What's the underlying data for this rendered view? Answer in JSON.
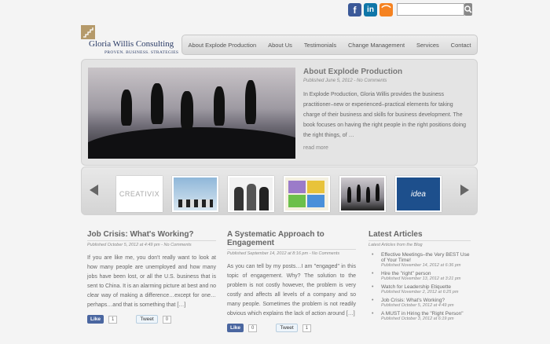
{
  "header": {
    "search": {
      "placeholder": ""
    },
    "social": [
      {
        "name": "facebook",
        "glyph": "f"
      },
      {
        "name": "linkedin",
        "glyph": "in"
      },
      {
        "name": "rss",
        "glyph": "⌒"
      }
    ]
  },
  "logo": {
    "name": "Gloria Willis Consulting",
    "tagline": "PROVEN. BUSINESS. STRATEGIES"
  },
  "nav": [
    "About Explode Production",
    "About Us",
    "Testimonials",
    "Change Management",
    "Services",
    "Contact"
  ],
  "feature": {
    "title": "About Explode Production",
    "meta": "Published June 5, 2012 - No Comments",
    "body": "In Explode Production, Gloria Willis provides the business practitioner–new or experienced–practical elements for taking charge of their business and skills for business development.  The book focuses on having the right people in the right positions doing the right things, of …",
    "read_more": "read more"
  },
  "carousel": {
    "thumbs": [
      "CREATIVIX",
      "",
      "",
      "",
      "",
      "idea"
    ]
  },
  "posts": [
    {
      "title": "Job Crisis: What's Working?",
      "meta": "Published October 5, 2012 at 4:49 pm - No Comments",
      "body": "If you are like me, you don't really want to look at how many people are unemployed and how many jobs have been lost, or all the U.S. business that is sent to China. It is an alarming picture at best and no clear way of making a difference…except for one… perhaps…and that is something that […]",
      "like": "Like",
      "like_count": "1",
      "tweet": "Tweet",
      "tweet_count": "0"
    },
    {
      "title": "A Systematic Approach to Engagement",
      "meta": "Published September 14, 2012 at 8:16 pm - No Comments",
      "body": "As you can tell by my posts…I am \"engaged\" in this topic of engagement. Why? The solution to the problem is not costly however, the problem is very costly and affects all levels of a company and so many people.  Sometimes the problem is not readily obvious which explains the lack of action around […]",
      "like": "Like",
      "like_count": "0",
      "tweet": "Tweet",
      "tweet_count": "1"
    }
  ],
  "latest": {
    "title": "Latest Articles",
    "subtitle": "Latest Articles from the Blog",
    "items": [
      {
        "title": "Effective Meetings–the Very BEST Use of Your Time!",
        "meta": "Published November 14, 2012 at 6:36 pm"
      },
      {
        "title": "Hire the \"right\" person",
        "meta": "Published November 13, 2012 at 3:21 pm"
      },
      {
        "title": "Watch for Leadership Etiquette",
        "meta": "Published November 2, 2012 at 6:25 pm"
      },
      {
        "title": "Job Crisis: What's Working?",
        "meta": "Published October 5, 2012 at 4:49 pm"
      },
      {
        "title": "A MUST in Hiring the \"Right Person\"",
        "meta": "Published October 3, 2012 at 6:19 pm"
      }
    ]
  }
}
